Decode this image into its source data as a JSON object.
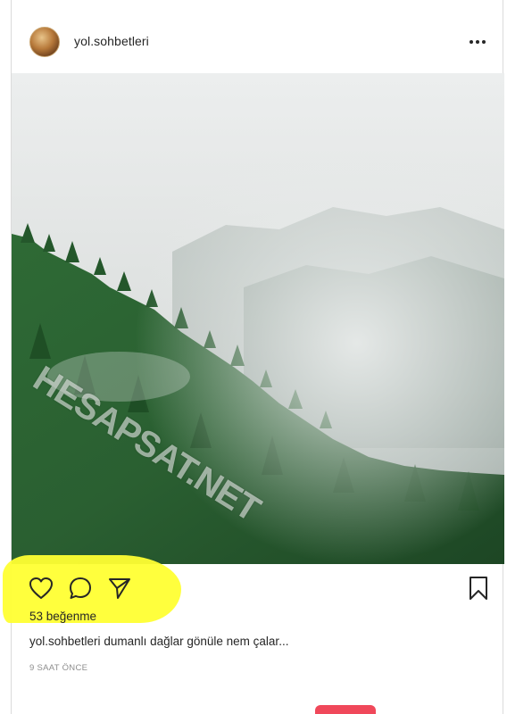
{
  "post": {
    "username": "yol.sohbetleri",
    "watermark": "HESAPSAT.NET",
    "likes_text": "53 beğenme",
    "caption_user": "yol.sohbetleri",
    "caption_text": "dumanlı dağlar gönüle nem çalar...",
    "time_text": "9 SAAT ÖNCE"
  },
  "icons": {
    "more": "more-options-icon",
    "like": "heart-icon",
    "comment": "comment-icon",
    "share": "paper-plane-icon",
    "save": "bookmark-icon"
  },
  "colors": {
    "highlight": "#ffff33",
    "text": "#262626",
    "muted": "#8e8e8e",
    "border": "#dbdbdb"
  }
}
